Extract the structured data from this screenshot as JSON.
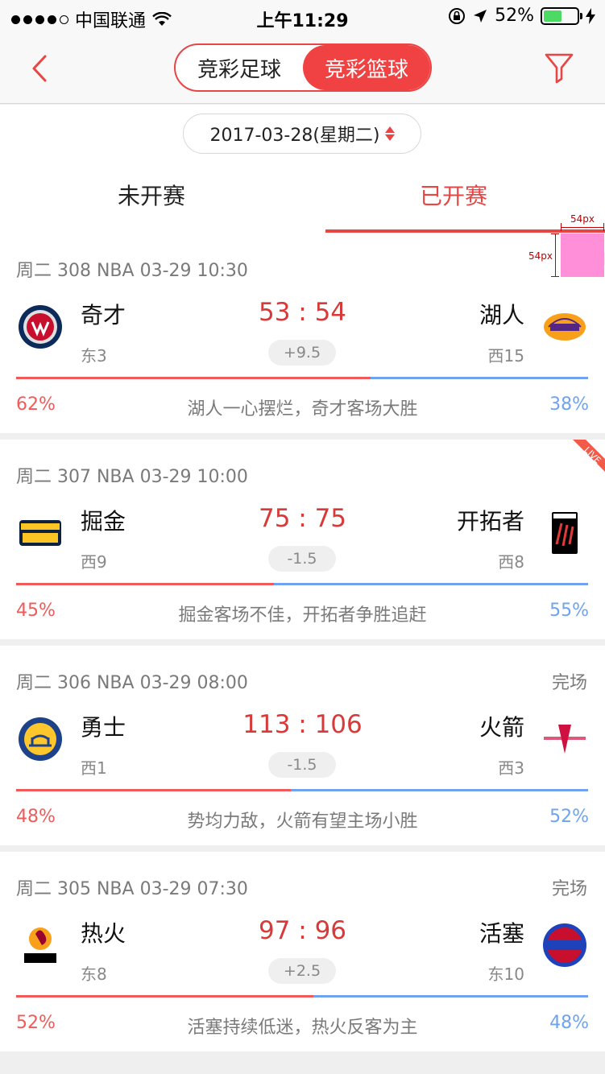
{
  "status": {
    "carrier": "中国联通",
    "time": "上午11:29",
    "battery": "52%",
    "battery_level": 0.52
  },
  "nav": {
    "segment_football": "竞彩足球",
    "segment_basketball": "竞彩篮球"
  },
  "date": "2017-03-28(星期二)",
  "tabs": {
    "not_started": "未开赛",
    "started": "已开赛"
  },
  "annotation": {
    "width_label": "54px",
    "height_label": "54px",
    "live_label": "LIVE"
  },
  "games": [
    {
      "meta": "周二 308 NBA 03-29 10:30",
      "state": "",
      "live": true,
      "home": {
        "name": "奇才",
        "rank": "东3",
        "logo": "wizards-logo",
        "pct": "62%",
        "pct_value": 0.62
      },
      "away": {
        "name": "湖人",
        "rank": "西15",
        "logo": "lakers-logo",
        "pct": "38%"
      },
      "score": "53 : 54",
      "spread": "+9.5",
      "comment": "湖人一心摆烂，奇才客场大胜"
    },
    {
      "meta": "周二 307 NBA 03-29 10:00",
      "state": "",
      "live": true,
      "home": {
        "name": "掘金",
        "rank": "西9",
        "logo": "nuggets-logo",
        "pct": "45%",
        "pct_value": 0.45
      },
      "away": {
        "name": "开拓者",
        "rank": "西8",
        "logo": "blazers-logo",
        "pct": "55%"
      },
      "score": "75 : 75",
      "spread": "-1.5",
      "comment": "掘金客场不佳，开拓者争胜追赶"
    },
    {
      "meta": "周二 306 NBA 03-29 08:00",
      "state": "完场",
      "live": false,
      "home": {
        "name": "勇士",
        "rank": "西1",
        "logo": "warriors-logo",
        "pct": "48%",
        "pct_value": 0.48
      },
      "away": {
        "name": "火箭",
        "rank": "西3",
        "logo": "rockets-logo",
        "pct": "52%"
      },
      "score": "113 : 106",
      "spread": "-1.5",
      "comment": "势均力敌，火箭有望主场小胜"
    },
    {
      "meta": "周二 305 NBA 03-29 07:30",
      "state": "完场",
      "live": false,
      "home": {
        "name": "热火",
        "rank": "东8",
        "logo": "heat-logo",
        "pct": "52%",
        "pct_value": 0.52
      },
      "away": {
        "name": "活塞",
        "rank": "东10",
        "logo": "pistons-logo",
        "pct": "48%"
      },
      "score": "97 : 96",
      "spread": "+2.5",
      "comment": "活塞持续低迷，热火反客为主"
    }
  ],
  "colors": {
    "accent": "#e84545",
    "away_blue": "#6fa3ef",
    "home_red": "#ef5b5b"
  }
}
